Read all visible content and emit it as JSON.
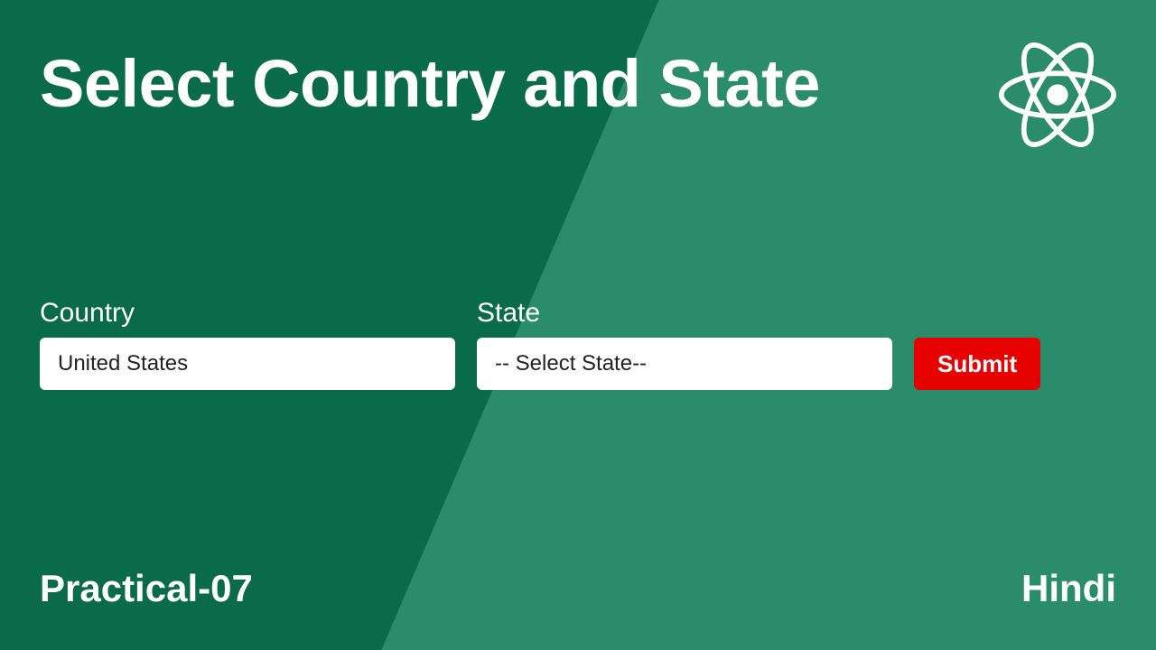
{
  "title": "Select Country and State",
  "logo": "react-icon",
  "form": {
    "country": {
      "label": "Country",
      "value": "United States"
    },
    "state": {
      "label": "State",
      "value": "-- Select State--"
    },
    "submit_label": "Submit"
  },
  "footer": {
    "left": "Practical-07",
    "right": "Hindi"
  },
  "colors": {
    "bg_dark": "#0a6b4a",
    "bg_light": "#2a8c6a",
    "submit": "#e60000",
    "text": "#ffffff"
  }
}
